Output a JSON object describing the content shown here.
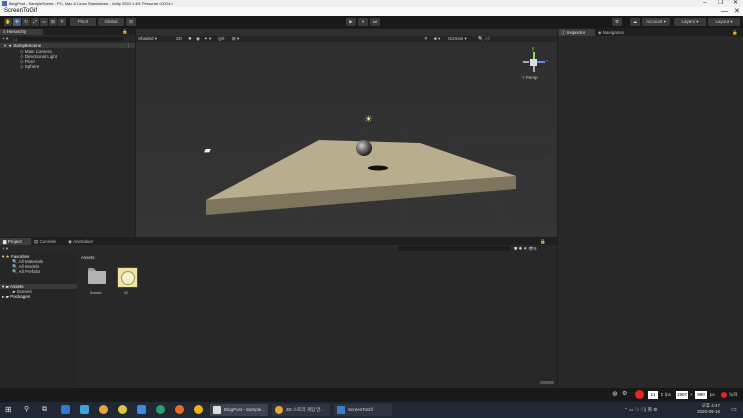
{
  "window": {
    "title": "BlogPost - SampleScene - PC, Mac & Linux Standalone - Unity 2020.1.4f1 Personal <DX11>",
    "controls": [
      "–",
      "❐",
      "✕"
    ]
  },
  "recorder": {
    "title": "ScreenToGif",
    "controls": [
      "—",
      "✕"
    ]
  },
  "toolbar": {
    "pivot": "Pivot",
    "global": "Global",
    "account": "Account",
    "layers": "Layers",
    "layout": "Layout",
    "play_icon": "▶",
    "pause_icon": "⏸",
    "step_icon": "⏭"
  },
  "hierarchy": {
    "tab": "Hierarchy",
    "search_placeholder": "All",
    "scene": "SampleScene",
    "items": [
      "Main Camera",
      "Directional Light",
      "Floor",
      "Sphere"
    ]
  },
  "scene_tabs": [
    {
      "label": "Scene"
    },
    {
      "label": "Game"
    },
    {
      "label": "Asset Store"
    },
    {
      "label": "Package Manager"
    },
    {
      "label": "Animator"
    }
  ],
  "scene_toolbar": {
    "shading": "Shaded",
    "mode_2d": "2D",
    "gizmos": "Gizmos",
    "search_placeholder": "All"
  },
  "scene_view": {
    "persp_label": "< Persp",
    "axis_y": "y",
    "axis_x": "x"
  },
  "inspector": {
    "tabs": [
      "Inspector",
      "Navigation"
    ]
  },
  "project": {
    "tabs": [
      "Project",
      "Console",
      "Animation"
    ],
    "favorites_label": "Favorites",
    "favorites": [
      "All Materials",
      "All Models",
      "All Prefabs"
    ],
    "assets_label": "Assets",
    "assets_tree": [
      "Scenes"
    ],
    "packages_label": "Packages",
    "breadcrumb": "Assets",
    "hidden_count": "6",
    "items": [
      {
        "label": "Scenes",
        "kind": "folder"
      },
      {
        "label": "02",
        "kind": "image"
      }
    ]
  },
  "status": {
    "fps_value": "11",
    "fps_unit": "fps",
    "width": "1907",
    "height": "990",
    "size_unit": "px",
    "record_label": "녹화"
  },
  "taskbar": {
    "apps": [
      {
        "label": "BlogPost - Sample..."
      },
      {
        "label": "3D 스토리 게임 만..."
      },
      {
        "label": "ScreenToGif"
      }
    ],
    "time": "오후 4:47",
    "date": "2020-09-16"
  },
  "colors": {
    "accent": "#3e7ec9",
    "record": "#e0281e",
    "floor": "#b8ad8d"
  }
}
